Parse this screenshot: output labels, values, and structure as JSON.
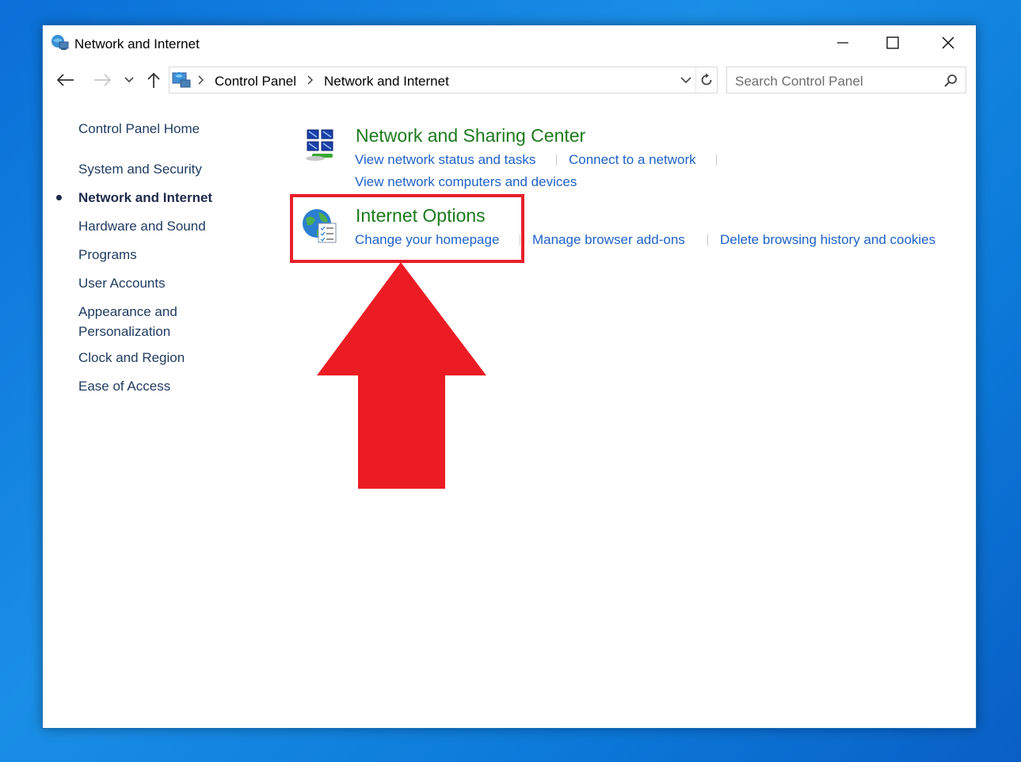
{
  "window": {
    "title": "Network and Internet",
    "controls": {
      "minimize": "minimize",
      "maximize": "maximize",
      "close": "close"
    }
  },
  "navbar": {
    "breadcrumbs": [
      "Control Panel",
      "Network and Internet"
    ],
    "search_placeholder": "Search Control Panel"
  },
  "sidebar": {
    "items": [
      {
        "label": "Control Panel Home",
        "active": false
      },
      {
        "label": "System and Security",
        "active": false
      },
      {
        "label": "Network and Internet",
        "active": true
      },
      {
        "label": "Hardware and Sound",
        "active": false
      },
      {
        "label": "Programs",
        "active": false
      },
      {
        "label": "User Accounts",
        "active": false
      },
      {
        "label": "Appearance and Personalization",
        "active": false
      },
      {
        "label": "Clock and Region",
        "active": false
      },
      {
        "label": "Ease of Access",
        "active": false
      }
    ]
  },
  "categories": [
    {
      "title": "Network and Sharing Center",
      "icon": "network-sharing-icon",
      "tasks": [
        "View network status and tasks",
        "Connect to a network",
        "View network computers and devices"
      ]
    },
    {
      "title": "Internet Options",
      "icon": "internet-options-globe-icon",
      "tasks": [
        "Change your homepage",
        "Manage browser add-ons",
        "Delete browsing history and cookies"
      ]
    }
  ],
  "annotation": {
    "highlight_color": "#e8202a",
    "arrow_color": "#ec1c24",
    "arrow_direction": "up"
  },
  "colors": {
    "category_title": "#1d7a1d",
    "task_link": "#1e62c8",
    "desktop": "#0b78d8"
  }
}
